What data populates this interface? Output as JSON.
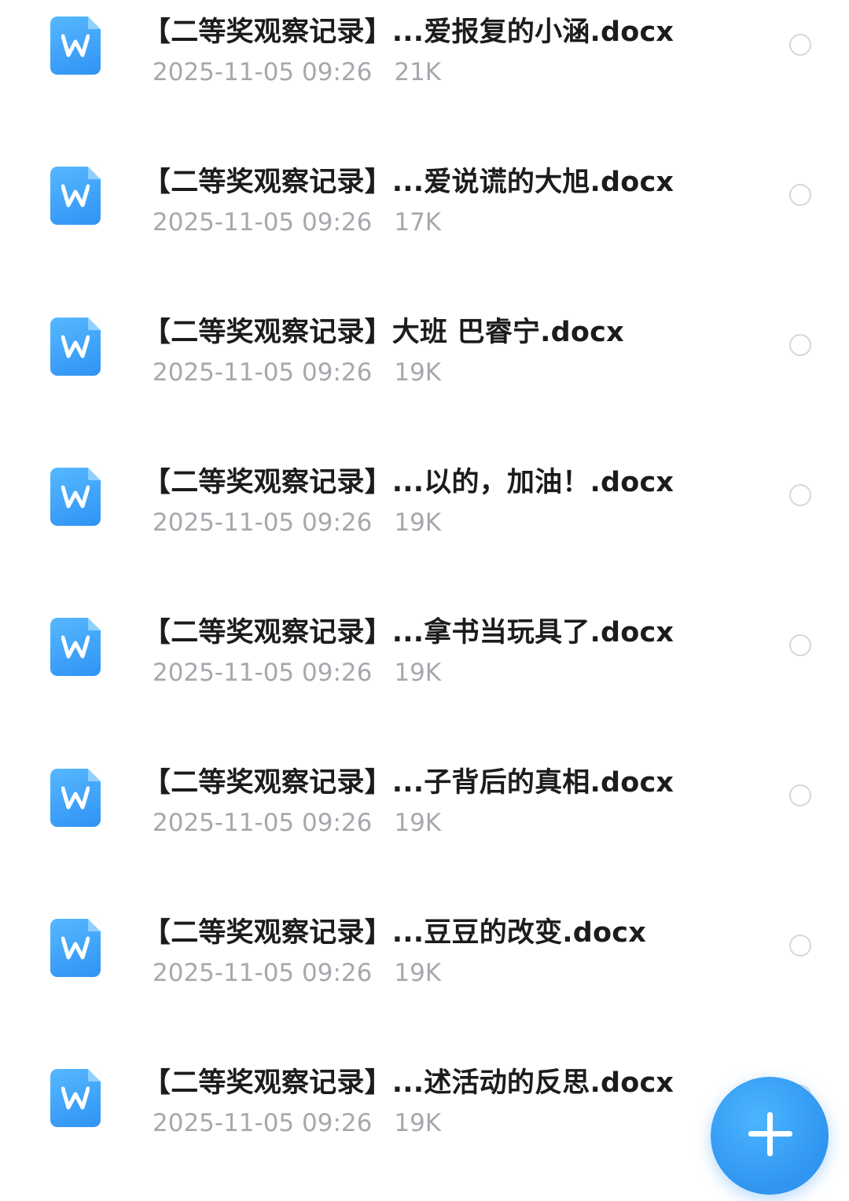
{
  "files": [
    {
      "name": "【二等奖观察记录】...爱报复的小涵.docx",
      "date": "2025-11-05 09:26",
      "size": "21K",
      "icon": "word-doc-icon"
    },
    {
      "name": "【二等奖观察记录】...爱说谎的大旭.docx",
      "date": "2025-11-05 09:26",
      "size": "17K",
      "icon": "word-doc-icon"
    },
    {
      "name": "【二等奖观察记录】大班 巴睿宁.docx",
      "date": "2025-11-05 09:26",
      "size": "19K",
      "icon": "word-doc-icon"
    },
    {
      "name": "【二等奖观察记录】...以的，加油！.docx",
      "date": "2025-11-05 09:26",
      "size": "19K",
      "icon": "word-doc-icon"
    },
    {
      "name": "【二等奖观察记录】...拿书当玩具了.docx",
      "date": "2025-11-05 09:26",
      "size": "19K",
      "icon": "word-doc-icon"
    },
    {
      "name": "【二等奖观察记录】...子背后的真相.docx",
      "date": "2025-11-05 09:26",
      "size": "19K",
      "icon": "word-doc-icon"
    },
    {
      "name": "【二等奖观察记录】...豆豆的改变.docx",
      "date": "2025-11-05 09:26",
      "size": "19K",
      "icon": "word-doc-icon"
    },
    {
      "name": "【二等奖观察记录】...述活动的反思.docx",
      "date": "2025-11-05 09:26",
      "size": "19K",
      "icon": "word-doc-icon"
    }
  ],
  "fab": {
    "icon": "plus-icon"
  },
  "colors": {
    "accent": "#2f93f4",
    "title_text": "#1c1c1e",
    "meta_text": "#a6a8ad",
    "radio_border": "#d6d7da"
  }
}
